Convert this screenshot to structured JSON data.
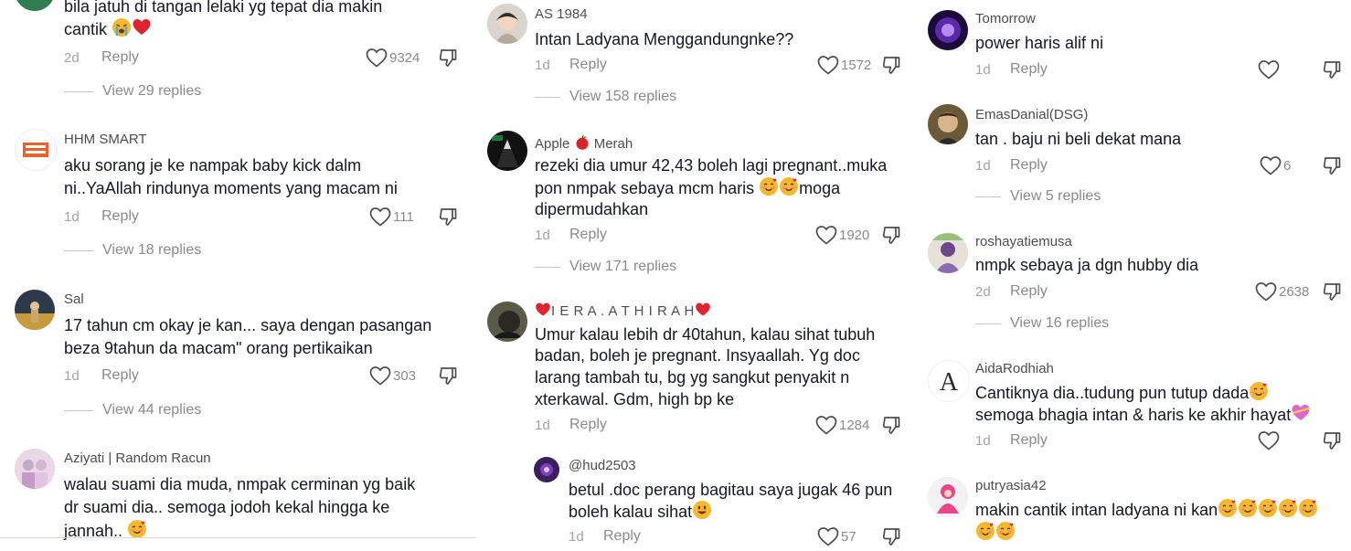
{
  "col1": {
    "c0": {
      "text1": "bila jatuh di tangan lelaki yg tepat dia makin",
      "text2": "cantik",
      "ago": "2d",
      "reply": "Reply",
      "likes": "9324",
      "view_replies": "View 29 replies"
    },
    "c1": {
      "user": "HHM SMART",
      "text1": "aku sorang je ke nampak baby kick dalm",
      "text2": "ni..YaAllah rindunya moments yang macam ni",
      "ago": "1d",
      "reply": "Reply",
      "likes": "111",
      "view_replies": "View 18 replies"
    },
    "c2": {
      "user": "Sal",
      "text1": "17 tahun cm okay je kan... saya dengan pasangan",
      "text2": "beza 9tahun da macam\" orang pertikaikan",
      "ago": "1d",
      "reply": "Reply",
      "likes": "303",
      "view_replies": "View 44 replies"
    },
    "c3": {
      "user": "Aziyati | Random Racun",
      "text1": "walau suami dia muda, nmpak cerminan yg baik",
      "text2": "dr suami dia.. semoga jodoh kekal hingga ke",
      "text3": "jannah.."
    }
  },
  "col2": {
    "c0": {
      "user": "AS 1984",
      "text1": "Intan Ladyana Menggandungnke??",
      "ago": "1d",
      "reply": "Reply",
      "likes": "1572",
      "view_replies": "View 158 replies"
    },
    "c1": {
      "user_a": "Apple",
      "user_b": "Merah",
      "text1": "rezeki dia umur 42,43 boleh lagi pregnant..muka",
      "text2": "pon nmpak sebaya mcm haris",
      "text2b": "moga",
      "text3": "dipermudahkan",
      "ago": "1d",
      "reply": "Reply",
      "likes": "1920",
      "view_replies": "View 171 replies"
    },
    "c2": {
      "user": "I E R A . A T H I R A H",
      "text1": "Umur kalau lebih dr 40tahun, kalau sihat tubuh",
      "text2": "badan, boleh je pregnant. Insyaallah. Yg doc",
      "text3": "larang tambah tu, bg yg sangkut penyakit n",
      "text4": "xterkawal. Gdm, high bp ke",
      "ago": "1d",
      "reply": "Reply",
      "likes": "1284"
    },
    "c3": {
      "user": "@hud2503",
      "text1": "betul .doc perang bagitau saya jugak 46 pun",
      "text2": "boleh kalau sihat",
      "ago": "1d",
      "reply": "Reply",
      "likes": "57"
    }
  },
  "col3": {
    "c0": {
      "user": "Tomorrow",
      "text1": "power haris alif ni",
      "ago": "1d",
      "reply": "Reply"
    },
    "c1": {
      "user": "EmasDanial(DSG)",
      "text1": "tan . baju ni beli dekat mana",
      "ago": "1d",
      "reply": "Reply",
      "likes": "6",
      "view_replies": "View 5 replies"
    },
    "c2": {
      "user": "roshayatiemusa",
      "text1": "nmpk sebaya ja dgn hubby dia",
      "ago": "2d",
      "reply": "Reply",
      "likes": "2638",
      "view_replies": "View 16 replies"
    },
    "c3": {
      "user": "AidaRodhiah",
      "text1": "Cantiknya dia..tudung pun tutup dada",
      "text2": "semoga bhagia intan & haris ke akhir hayat",
      "ago": "1d",
      "reply": "Reply"
    },
    "c4": {
      "user": "putryasia42",
      "text1": "makin cantik intan ladyana ni kan"
    }
  },
  "icons": {
    "like": "heart-outline-icon",
    "dislike": "thumb-down-outline-icon",
    "emoji_blush": "smiling-face-with-hearts-emoji",
    "emoji_cry": "loudly-crying-emoji",
    "emoji_heart": "red-heart-emoji",
    "emoji_apple": "red-apple-emoji",
    "emoji_smile": "smiling-face-emoji",
    "emoji_pink_heart": "heart-with-ribbon-emoji"
  },
  "colors": {
    "text": "#161823",
    "meta": "#8a8a8a",
    "heart": "#e23b3b",
    "blush_face": "#f5b82e"
  }
}
